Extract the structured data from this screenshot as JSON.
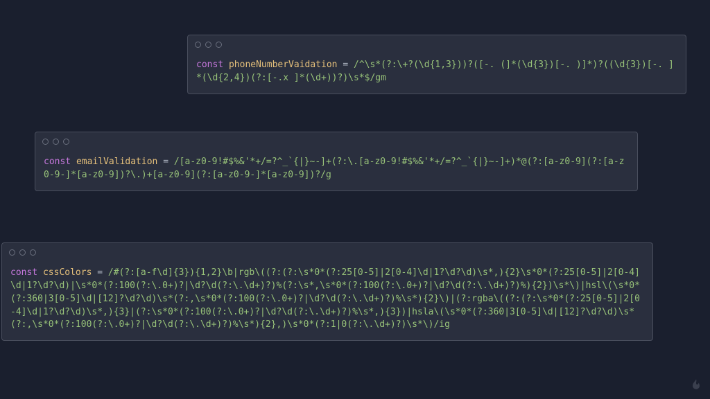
{
  "windows": [
    {
      "declKeyword": "const",
      "varName": "phoneNumberVaidation",
      "assignOp": " = ",
      "regex": "/^\\s*(?:\\+?(\\d{1,3}))?([-. (]*(\\d{3})[-. )]*)?((\\d{3})[-. ]*(\\d{2,4})(?:[-.x ]*(\\d+))?)\\s*$/gm"
    },
    {
      "declKeyword": "const",
      "varName": "emailValidation",
      "assignOp": " = ",
      "regex": "/[a-z0-9!#$%&'*+/=?^_`{|}~-]+(?:\\.[a-z0-9!#$%&'*+/=?^_`{|}~-]+)*@(?:[a-z0-9](?:[a-z0-9-]*[a-z0-9])?\\.)+[a-z0-9](?:[a-z0-9-]*[a-z0-9])?/g"
    },
    {
      "declKeyword": "const",
      "varName": "cssColors",
      "assignOp": " = ",
      "regex": "/#(?:[a-f\\d]{3}){1,2}\\b|rgb\\((?:(?:\\s*0*(?:25[0-5]|2[0-4]\\d|1?\\d?\\d)\\s*,){2}\\s*0*(?:25[0-5]|2[0-4]\\d|1?\\d?\\d)|\\s*0*(?:100(?:\\.0+)?|\\d?\\d(?:\\.\\d+)?)%(?:\\s*,\\s*0*(?:100(?:\\.0+)?|\\d?\\d(?:\\.\\d+)?)%){2})\\s*\\)|hsl\\(\\s*0*(?:360|3[0-5]\\d|[12]?\\d?\\d)\\s*(?:,\\s*0*(?:100(?:\\.0+)?|\\d?\\d(?:\\.\\d+)?)%\\s*){2}\\)|(?:rgba\\((?:(?:\\s*0*(?:25[0-5]|2[0-4]\\d|1?\\d?\\d)\\s*,){3}|(?:\\s*0*(?:100(?:\\.0+)?|\\d?\\d(?:\\.\\d+)?)%\\s*,){3})|hsla\\(\\s*0*(?:360|3[0-5]\\d|[12]?\\d?\\d)\\s*(?:,\\s*0*(?:100(?:\\.0+)?|\\d?\\d(?:\\.\\d+)?)%\\s*){2},)\\s*0*(?:1|0(?:\\.\\d+)?)\\s*\\)/ig"
    }
  ],
  "iconName": "flame-icon"
}
